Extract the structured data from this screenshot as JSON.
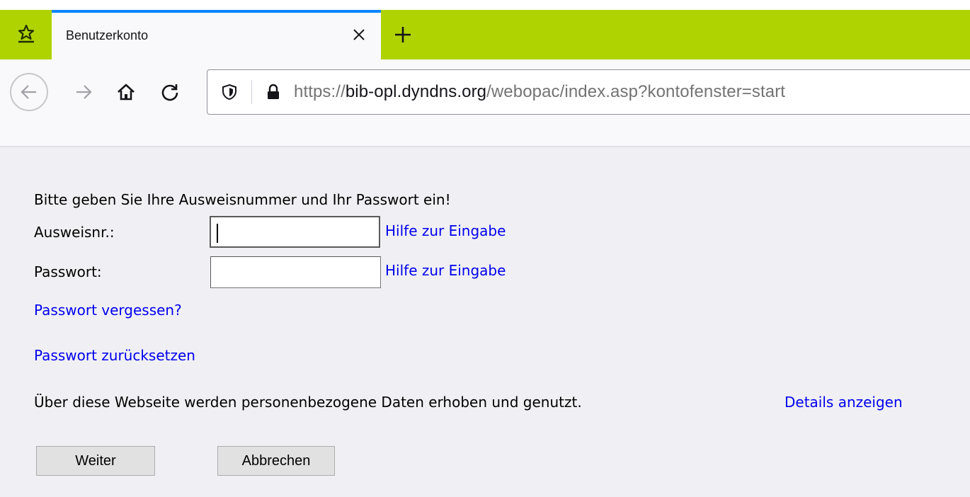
{
  "browser": {
    "tab": {
      "title": "Benutzerkonto"
    },
    "url": {
      "scheme": "https://",
      "host": "bib-opl.dyndns.org",
      "path": "/webopac/index.asp?kontofenster=start"
    }
  },
  "page": {
    "intro": "Bitte geben Sie Ihre Ausweisnummer und Ihr Passwort ein!",
    "card_label": "Ausweisnr.:",
    "card_value": "",
    "password_label": "Passwort:",
    "password_value": "",
    "help_link": "Hilfe zur Eingabe",
    "forgot_link": "Passwort vergessen?",
    "reset_link": "Passwort zurücksetzen",
    "privacy_text": "Über diese Webseite werden personenbezogene Daten erhoben und genutzt.",
    "privacy_link": "Details anzeigen",
    "continue_button": "Weiter",
    "cancel_button": "Abbrechen"
  },
  "colors": {
    "tabstrip": "#aed300",
    "link": "#0000ee",
    "active_tab_accent": "#0a84ff"
  },
  "icons": [
    "pinned-tab-icon",
    "close-icon",
    "plus-icon",
    "back-icon",
    "forward-icon",
    "home-icon",
    "reload-icon",
    "shield-icon",
    "lock-icon"
  ]
}
